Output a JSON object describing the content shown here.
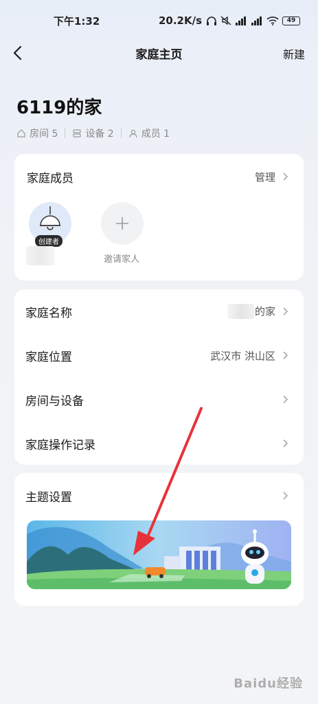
{
  "status": {
    "time": "下午1:32",
    "speed": "20.2K/s",
    "battery": "49"
  },
  "nav": {
    "title": "家庭主页",
    "new_label": "新建"
  },
  "home": {
    "name": "6119的家",
    "rooms": "房间 5",
    "devices": "设备 2",
    "members": "成员 1"
  },
  "members_card": {
    "title": "家庭成员",
    "manage_label": "管理",
    "creator_badge": "创建者",
    "invite_label": "邀请家人"
  },
  "info_card": {
    "rows": [
      {
        "label": "家庭名称",
        "value": "的家"
      },
      {
        "label": "家庭位置",
        "value": "武汉市 洪山区"
      },
      {
        "label": "房间与设备",
        "value": ""
      },
      {
        "label": "家庭操作记录",
        "value": ""
      }
    ]
  },
  "theme_card": {
    "title": "主题设置"
  },
  "watermark": "Baidu经验",
  "colors": {
    "arrow": "#e8323a",
    "avatar_bg": "#dfe9f7"
  }
}
